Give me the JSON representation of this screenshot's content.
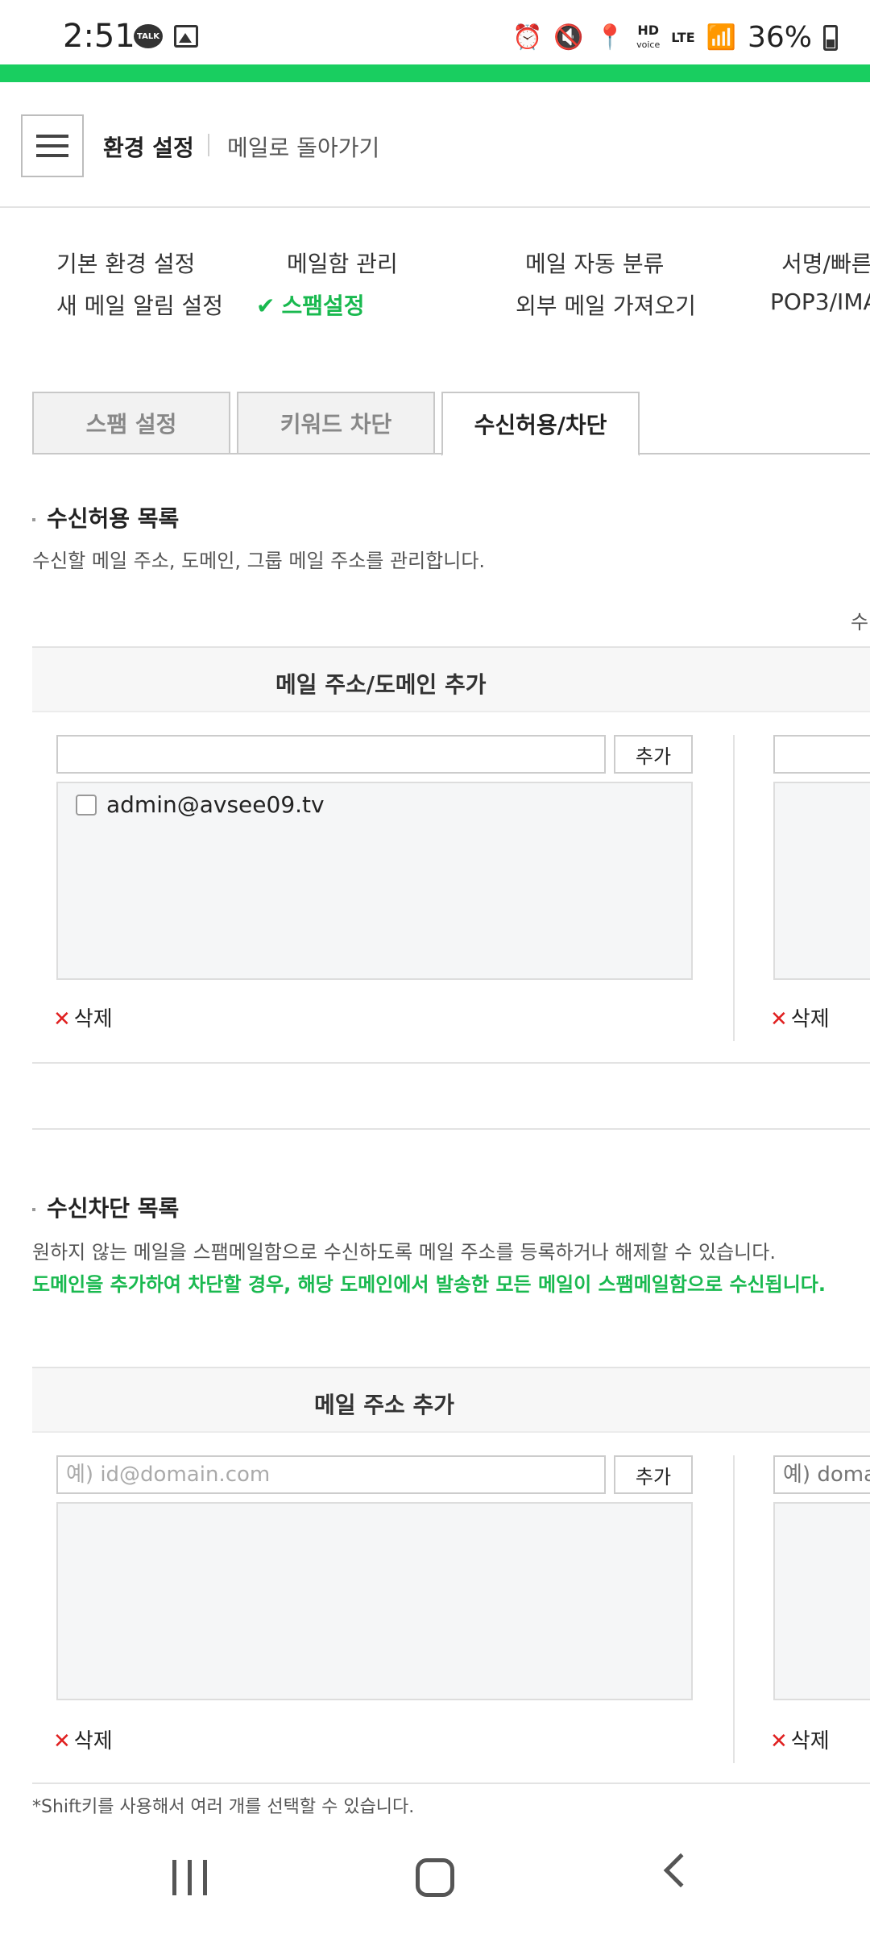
{
  "status_bar": {
    "time": "2:51",
    "talk_label": "TALK",
    "network_hd": "HD",
    "network_voice": "voice",
    "network_lte": "LTE",
    "battery": "36%"
  },
  "header": {
    "title": "환경 설정",
    "back_link": "메일로 돌아가기"
  },
  "settings_nav": {
    "row1": [
      "기본 환경 설정",
      "메일함 관리",
      "메일 자동 분류",
      "서명/빠른"
    ],
    "row2": [
      "새 메일 알림 설정",
      "스팸설정",
      "외부 메일 가져오기",
      "POP3/IMA"
    ]
  },
  "tabs": [
    {
      "label": "스팸 설정"
    },
    {
      "label": "키워드 차단"
    },
    {
      "label": "수신허용/차단"
    }
  ],
  "allow_section": {
    "title": "수신허용 목록",
    "description": "수신할 메일 주소, 도메인, 그룹 메일 주소를 관리합니다.",
    "right_cut_text": "수",
    "panel_title": "메일 주소/도메인 추가",
    "add_label": "추가",
    "entries": [
      "admin@avsee09.tv"
    ],
    "delete_label": "삭제"
  },
  "block_section": {
    "title": "수신차단 목록",
    "description": "원하지 않는 메일을 스팸메일함으로 수신하도록 메일 주소를 등록하거나 해제할 수 있습니다.",
    "warning": "도메인을 추가하여 차단할 경우, 해당 도메인에서 발송한 모든 메일이 스팸메일함으로 수신됩니다.",
    "panel_title": "메일 주소 추가",
    "input_placeholder": "예) id@domain.com",
    "right_input_placeholder": "예) domai",
    "add_label": "추가",
    "delete_label": "삭제"
  },
  "footnote": "*Shift키를 사용해서 여러 개를 선택할 수 있습니다.",
  "colors": {
    "brand_green": "#19ce60",
    "active_green": "#19b94f",
    "delete_red": "#e02020"
  }
}
